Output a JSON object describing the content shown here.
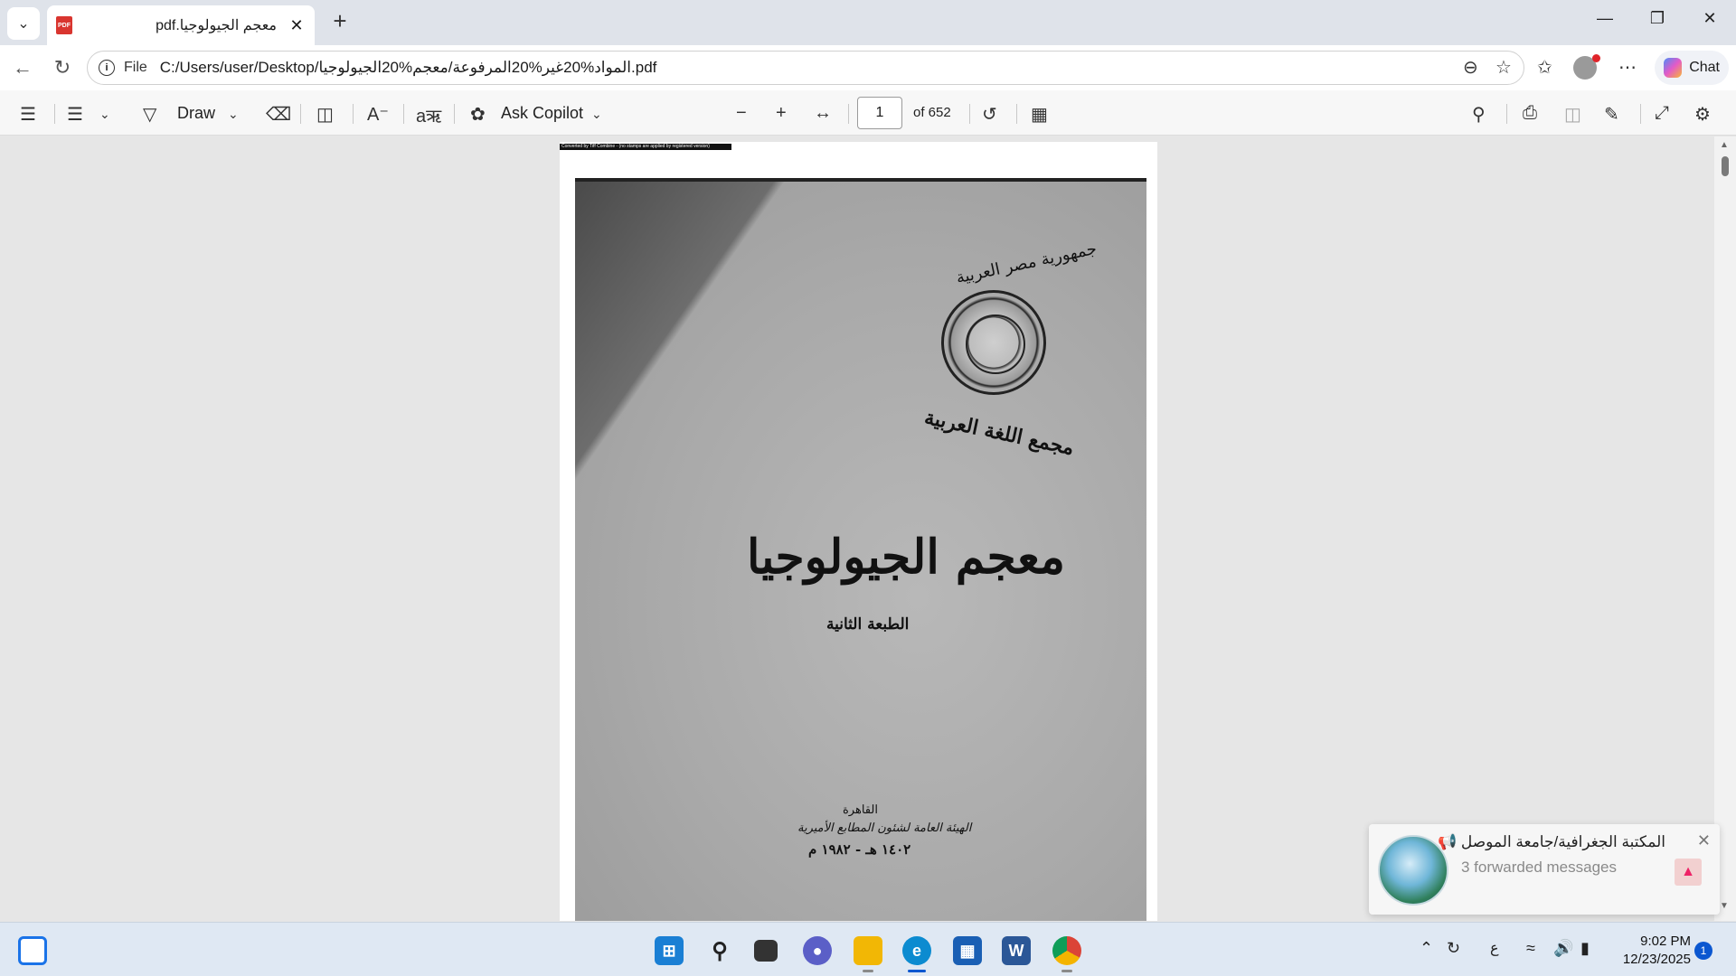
{
  "tab": {
    "title": "معجم الجيولوجيا.pdf",
    "pdf_icon_label": "PDF"
  },
  "address": {
    "scheme": "File",
    "url": "C:/Users/user/Desktop/المواد%20غير%20المرفوعة/معجم%20الجيولوجيا.pdf"
  },
  "chat_label": "Chat",
  "toolbar": {
    "draw_label": "Draw",
    "ask_copilot_label": "Ask Copilot",
    "page_current": "1",
    "page_total": "of 652"
  },
  "pdf": {
    "strip_text": "Converted by Tiff Combine - (no stamps are applied by registered version)",
    "republic": "جمهورية مصر العربية",
    "academy": "مجمع اللغة العربية",
    "title": "معجم الجيولوجيا",
    "edition": "الطبعة الثانية",
    "city": "القاهرة",
    "publisher": "الهيئة العامة لشئون المطابع الأميرية",
    "date": "١٤٠٢ هـ - ١٩٨٢ م"
  },
  "notification": {
    "title": "المكتبة الجغرافية/جامعة الموصل 📢",
    "subtitle": "3 forwarded messages"
  },
  "taskbar": {
    "tray_lang": "ع",
    "time": "9:02 PM",
    "date": "12/23/2025",
    "badge": "1",
    "word_label": "W"
  },
  "colors": {
    "accent": "#0b57d0",
    "pdf_red": "#d9352f",
    "taskbar_bg": "#dfe8f3",
    "viewer_bg": "#e6e6e6"
  }
}
